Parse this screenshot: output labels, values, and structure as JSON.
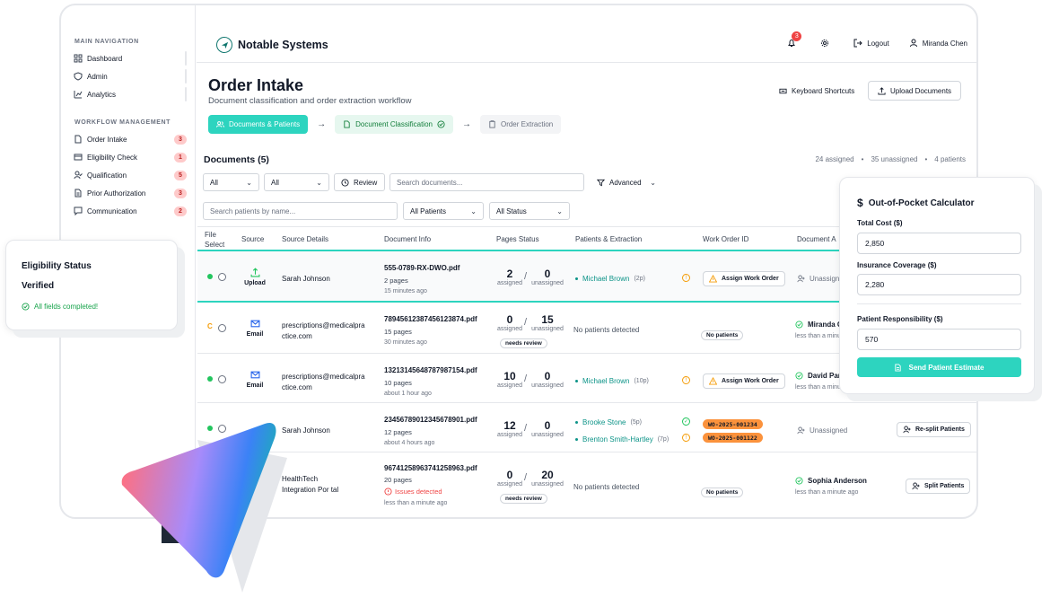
{
  "sidebar": {
    "main_title": "MAIN NAVIGATION",
    "main_items": [
      {
        "label": "Dashboard",
        "icon": "grid-icon"
      },
      {
        "label": "Admin",
        "icon": "shield-icon"
      },
      {
        "label": "Analytics",
        "icon": "chart-icon"
      }
    ],
    "workflow_title": "WORKFLOW MANAGEMENT",
    "workflow_items": [
      {
        "label": "Order Intake",
        "count": "3",
        "icon": "file-icon"
      },
      {
        "label": "Eligibility Check",
        "count": "1",
        "icon": "card-icon"
      },
      {
        "label": "Qualification",
        "count": "5",
        "icon": "user-check-icon"
      },
      {
        "label": "Prior Authorization",
        "count": "3",
        "icon": "file-text-icon"
      },
      {
        "label": "Communication",
        "count": "2",
        "icon": "message-icon"
      }
    ]
  },
  "topbar": {
    "brand": "Notable Systems",
    "notifications": "3",
    "logout": "Logout",
    "user": "Miranda Chen"
  },
  "header": {
    "title": "Order Intake",
    "subtitle": "Document classification and order extraction workflow",
    "keyboard_shortcuts": "Keyboard Shortcuts",
    "upload_documents": "Upload Documents"
  },
  "steps": [
    {
      "label": "Documents & Patients",
      "state": "active"
    },
    {
      "label": "Document Classification",
      "state": "done"
    },
    {
      "label": "Order Extraction",
      "state": "pending"
    }
  ],
  "documents": {
    "title": "Documents (5)",
    "stats": [
      "24 assigned",
      "•",
      "35 unassigned",
      "•",
      "4 patients"
    ]
  },
  "filters": {
    "filter1": "All",
    "filter2": "All",
    "review": "Review",
    "search_placeholder": "Search documents...",
    "advanced": "Advanced",
    "patient_search_placeholder": "Search patients by name...",
    "patients_filter": "All Patients",
    "status_filter": "All Status"
  },
  "table": {
    "headers": {
      "select_1": "File",
      "select_2": "Select",
      "source": "Source",
      "source_details": "Source Details",
      "document_info": "Document Info",
      "pages_status": "Pages Status",
      "patients": "Patients & Extraction",
      "work_order": "Work Order ID",
      "document_a": "Document A"
    },
    "assigned_label": "assigned",
    "unassigned_label": "unassigned",
    "rows": [
      {
        "source": "Upload",
        "details": "Sarah Johnson",
        "doc": "555-0789-RX-DWO.pdf",
        "pages": "2 pages",
        "time": "15 minutes ago",
        "assigned": "2",
        "unassigned": "0",
        "patient": "Michael Brown",
        "patient_pages": "(2p)",
        "work_order_btn": "Assign Work Order",
        "assignee": "Unassigned"
      },
      {
        "status_letter": "C",
        "source": "Email",
        "details": "prescriptions@medicalpra ctice.com",
        "doc": "78945612387456123874.pdf",
        "pages": "15 pages",
        "time": "30 minutes ago",
        "assigned": "0",
        "unassigned": "15",
        "review_pill": "needs review",
        "no_patients": "No patients detected",
        "wo_pill": "No patients",
        "assignee": "Miranda C",
        "assignee_time": "less than a minu"
      },
      {
        "source": "Email",
        "details": "prescriptions@medicalpra ctice.com",
        "doc": "13213145648787987154.pdf",
        "pages": "10 pages",
        "time": "about 1 hour ago",
        "assigned": "10",
        "unassigned": "0",
        "patient": "Michael Brown",
        "patient_pages": "(10p)",
        "work_order_btn": "Assign Work Order",
        "assignee": "David Par",
        "assignee_time": "less than a minu"
      },
      {
        "details": "Sarah Johnson",
        "doc": "23456789012345678901.pdf",
        "pages": "12 pages",
        "time": "about 4 hours ago",
        "assigned": "12",
        "unassigned": "0",
        "patient": "Brooke Stone",
        "patient_pages": "(5p)",
        "patient2": "Brenton Smith-Hartley",
        "patient2_pages": "(7p)",
        "wo1": "WO-2025-001234",
        "wo2": "WO-2025-001122",
        "assignee": "Unassigned",
        "action": "Re-split Patients"
      },
      {
        "details": "HealthTech Integration Por tal",
        "doc": "96741258963741258963.pdf",
        "pages": "20 pages",
        "issues": "Issues detected",
        "time": "less than a minute ago",
        "assigned": "0",
        "unassigned": "20",
        "review_pill": "needs review",
        "no_patients": "No patients detected",
        "wo_pill": "No patients",
        "assignee": "Sophia Anderson",
        "assignee_time": "less than a minute ago",
        "action": "Split Patients"
      }
    ]
  },
  "eligibility_card": {
    "title": "Eligibility Status",
    "status": "Verified",
    "note": "All fields completed!"
  },
  "calculator": {
    "title": "Out-of-Pocket Calculator",
    "total_cost_label": "Total Cost ($)",
    "total_cost": "2,850",
    "coverage_label": "Insurance Coverage ($)",
    "coverage": "2,280",
    "responsibility_label": "Patient Responsibility ($)",
    "responsibility": "570",
    "send": "Send Patient Estimate"
  },
  "colors": {
    "accent": "#2dd4bf",
    "teal_text": "#0d9488",
    "warning": "#f59e0b",
    "success": "#22c55e",
    "danger": "#ef4444",
    "wo_tag": "#fb923c"
  }
}
